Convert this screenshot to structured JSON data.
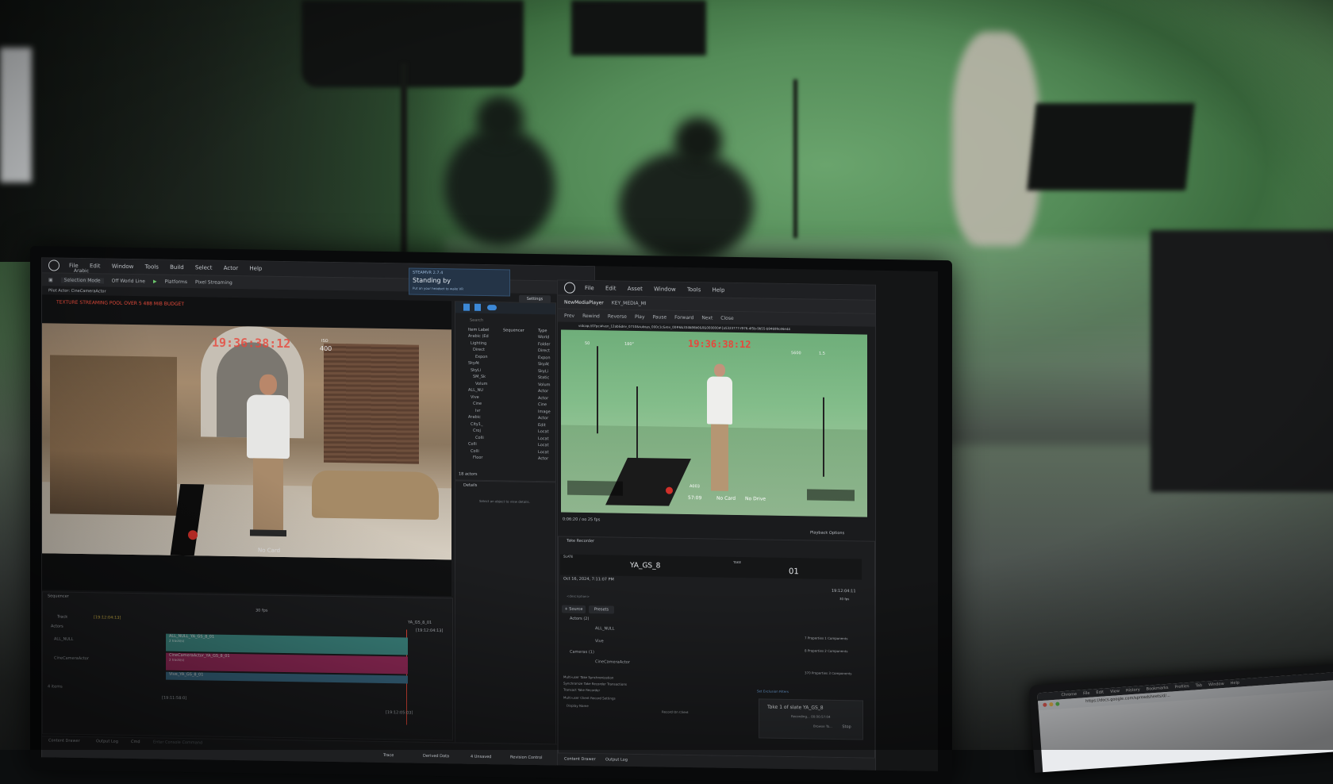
{
  "editor": {
    "menu": [
      "File",
      "Edit",
      "Window",
      "Tools",
      "Build",
      "Select",
      "Actor",
      "Help"
    ],
    "level_tab": "Arabic",
    "selection_mode": "Selection Mode",
    "world": "Off World Line",
    "platforms": "Platforms",
    "pixel_streaming": "Pixel Streaming",
    "settings": "Settings",
    "pilot_actor": "Pilot Actor: CineCameraActor",
    "warning": "TEXTURE STREAMING POOL OVER 5 488 MiB BUDGET",
    "viewport_timecode": "19:36:38:12",
    "iso_label": "ISO",
    "iso_value": "400",
    "bottom_hud": "No Card",
    "steamvr_title": "STEAMVR 2.7.4",
    "steamvr_status": "Standing by",
    "steamvr_hint": "Put on your headset to wake VR"
  },
  "outliner": {
    "search": "Search",
    "col_label": "Item Label",
    "col_sequencer": "Sequencer",
    "col_type": "Type",
    "items": [
      {
        "label": "Arabic (Ed",
        "type": "World"
      },
      {
        "label": "Lighting",
        "type": "Folder"
      },
      {
        "label": "Direct",
        "type": "Direct"
      },
      {
        "label": "Expon",
        "type": "Expon"
      },
      {
        "label": "SkyAt",
        "type": "SkyAt"
      },
      {
        "label": "SkyLi",
        "type": "SkyLi"
      },
      {
        "label": "SM_Sk",
        "type": "Static"
      },
      {
        "label": "Volum",
        "type": "Volum"
      },
      {
        "label": "ALL_NU",
        "type": "Actor"
      },
      {
        "label": "Vive",
        "type": "Actor"
      },
      {
        "label": "Cine",
        "type": "Cine"
      },
      {
        "label": "Ivr",
        "type": "Image"
      },
      {
        "label": "Arabic",
        "type": "Actor"
      },
      {
        "label": "City1_",
        "type": "Edit"
      },
      {
        "label": "Croj",
        "type": "Locat"
      },
      {
        "label": "Colli",
        "type": "Locat"
      },
      {
        "label": "Colli",
        "type": "Locat"
      },
      {
        "label": "Colli",
        "type": "Locat"
      },
      {
        "label": "Floor",
        "type": "Actor"
      }
    ],
    "count": "18 actors",
    "details_tab": "Details",
    "details_hint": "Select an object to view details."
  },
  "sequencer": {
    "tab": "Sequencer",
    "track_btn": "Track",
    "timecode_start": "[19:12:04:13]",
    "fps": "30 fps",
    "sequence_name": "YA_GS_8_01",
    "end_timecode": "[19:12:04:13]",
    "tracks_header": "Actors",
    "rows": [
      "ALL_NULL",
      "CineCameraActor"
    ],
    "clips": [
      "ALL_NULL_YA_GS_8_01",
      "CineCameraActor_YA_GS_8_01",
      "Vive_YA_GS_8_01"
    ],
    "clip_sub": [
      "2 track(s)",
      "2 track(s)"
    ],
    "item_count": "4 items",
    "bottom_left_tc": "[19:11:58:0]",
    "bottom_right_tc": "[19:12:05:03]"
  },
  "statusbar": {
    "content_drawer": "Content Drawer",
    "output_log": "Output Log",
    "cmd": "Cmd",
    "console_placeholder": "Enter Console Command",
    "trace": "Trace",
    "derived": "Derived Data",
    "unsaved": "4 Unsaved",
    "revision": "Revision Control"
  },
  "media": {
    "menu": [
      "File",
      "Edit",
      "Asset",
      "Window",
      "Tools",
      "Help"
    ],
    "tab1": "NewMediaPlayer",
    "tab2": "KEY_MEDIA_MI",
    "controls": [
      "Prev",
      "Rewind",
      "Reverse",
      "Play",
      "Pause",
      "Forward",
      "Next",
      "Close"
    ],
    "url": "vidcap://0?pci#ven_12ab&dev_0710&subsys_000c1c&rev_00#6&334b86b0&0&000000#{a5323777-f976-4f5b-9b55-b94699c46e44",
    "timecode": "19:36:38:12",
    "hud_top": [
      "50",
      "180°",
      "5600",
      "1.5"
    ],
    "hud_bottom": [
      "A003",
      "57:09",
      "No Card",
      "No Drive"
    ],
    "time_line": "0:06:20 / oo  25 fps",
    "playback_options": "Playback Options"
  },
  "take_recorder": {
    "tab": "Take Recorder",
    "slate_label": "SLATE",
    "slate": "YA_GS_8",
    "take_label": "TAKE",
    "take": "01",
    "date": "Oct 16, 2024, 7:11:07 PM",
    "time": "19:12:04:11",
    "fps": "30 fps",
    "description": "<description>",
    "source_btn": "+ Source",
    "presets_btn": "Presets",
    "actors_header": "Actors (2)",
    "actor1": "ALL_NULL",
    "actor1_props": "7 Properties 1 Components",
    "actor2": "Vive",
    "actor2_props": "8 Properties 2 Components",
    "cameras_header": "Cameras (1)",
    "camera1": "CineCameraActor",
    "camera1_props": "370 Properties 3 Components",
    "multi_user": "Multi-user Take Synchronization",
    "sync_label": "Synchronize Take Recorder Transactions",
    "transact_filter": "Transact Take Recorder",
    "exclusion": "Set Exclusion Filters",
    "client_settings": "Multi-user Client Record Settings",
    "display_name": "Display Name",
    "record_on_client": "Record On Client",
    "toast_title": "Take 1 of slate YA_GS_8",
    "toast_sub": "Recording... 00:00:57:04",
    "browse": "Browse To...",
    "stop": "Stop"
  },
  "media_statusbar": {
    "content_drawer": "Content Drawer",
    "output_log": "Output Log"
  },
  "laptop": {
    "menu": [
      "Chrome",
      "File",
      "Edit",
      "View",
      "History",
      "Bookmarks",
      "Profiles",
      "Tab",
      "Window",
      "Help"
    ],
    "url": "https://docs.google.com/spreadsheets/d/..."
  }
}
